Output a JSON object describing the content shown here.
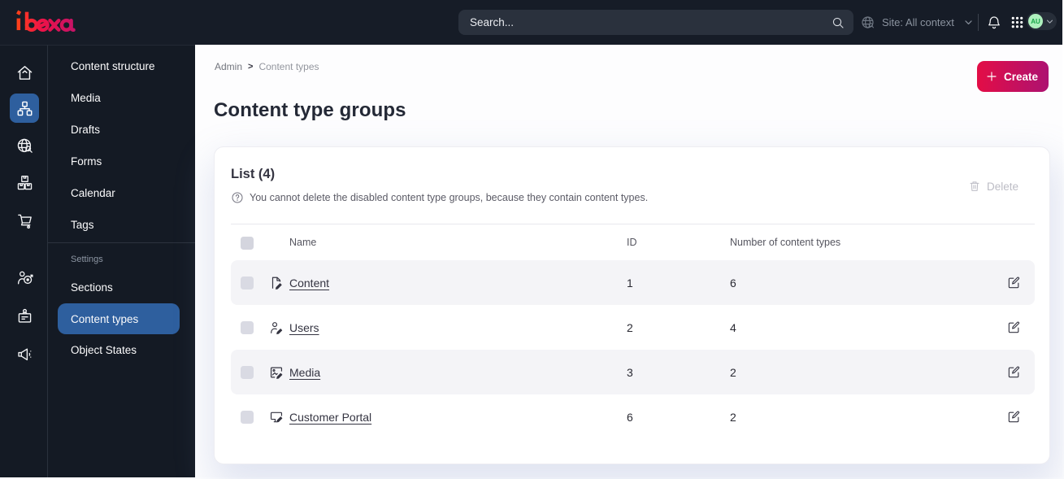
{
  "topbar": {
    "logo_text": "ibexa",
    "search_placeholder": "Search...",
    "site_context_label": "Site: All context",
    "avatar_initials": "AU"
  },
  "sidebar": {
    "rail_items": [
      {
        "name": "dashboard",
        "icon": "home-icon",
        "active": false
      },
      {
        "name": "content",
        "icon": "sitemap-icon",
        "active": true
      },
      {
        "name": "site-management",
        "icon": "globe-search-icon",
        "active": false
      },
      {
        "name": "products",
        "icon": "boxes-icon",
        "active": false
      },
      {
        "name": "commerce",
        "icon": "cart-icon",
        "active": false
      },
      {
        "name": "customers",
        "icon": "person-target-icon",
        "active": false
      },
      {
        "name": "corporate",
        "icon": "id-badge-icon",
        "active": false
      },
      {
        "name": "campaigns",
        "icon": "megaphone-icon",
        "active": false
      }
    ],
    "menu_items": [
      {
        "label": "Content structure"
      },
      {
        "label": "Media"
      },
      {
        "label": "Drafts"
      },
      {
        "label": "Forms"
      },
      {
        "label": "Calendar"
      },
      {
        "label": "Tags"
      }
    ],
    "section_label": "Settings",
    "settings_items": [
      {
        "label": "Sections",
        "active": false
      },
      {
        "label": "Content types",
        "active": true
      },
      {
        "label": "Object States",
        "active": false
      }
    ]
  },
  "main": {
    "breadcrumb": {
      "root": "Admin",
      "current": "Content types"
    },
    "title": "Content type groups",
    "create_label": "Create",
    "card": {
      "list_title": "List (4)",
      "info_text": "You cannot delete the disabled content type groups, because they contain content types.",
      "delete_label": "Delete",
      "table": {
        "headers": {
          "name": "Name",
          "id": "ID",
          "count": "Number of content types"
        },
        "rows": [
          {
            "icon": "file-edit-icon",
            "name": "Content",
            "id": "1",
            "count": "6"
          },
          {
            "icon": "user-edit-icon",
            "name": "Users",
            "id": "2",
            "count": "4"
          },
          {
            "icon": "image-edit-icon",
            "name": "Media",
            "id": "3",
            "count": "2"
          },
          {
            "icon": "monitor-edit-icon",
            "name": "Customer Portal",
            "id": "6",
            "count": "2"
          }
        ]
      }
    }
  },
  "colors": {
    "topbar_bg": "#161c27",
    "sidebar_bg": "#141a24",
    "active_blue": "#2e5f9e",
    "create_gradient_start": "#e30d46",
    "create_gradient_end": "#ad1271",
    "stripe": "#f4f4f7",
    "text_dark": "#343441",
    "avatar_green": "#aef0bd"
  }
}
